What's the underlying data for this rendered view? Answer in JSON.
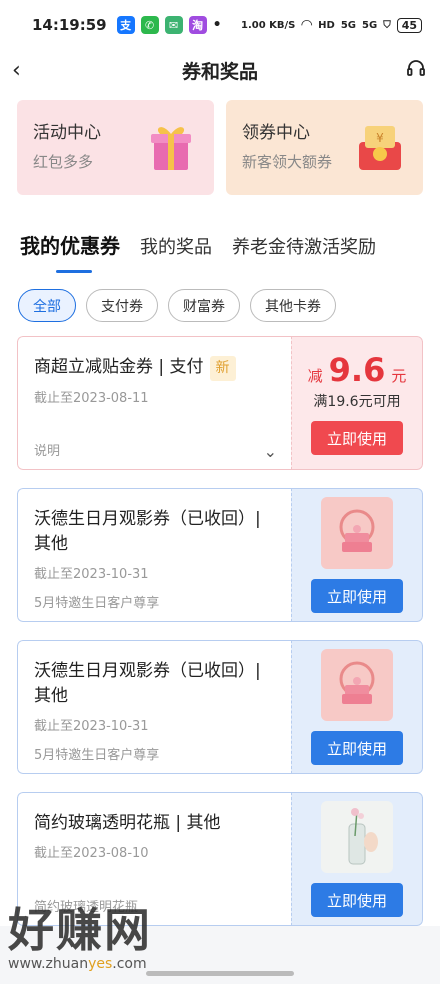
{
  "status": {
    "time": "14:19:59",
    "speed": "1.00 KB/S",
    "net1": "HD",
    "net2": "5G",
    "net3": "5G",
    "battery": "45"
  },
  "header": {
    "title": "券和奖品"
  },
  "top_cards": [
    {
      "title": "活动中心",
      "subtitle": "红包多多"
    },
    {
      "title": "领券中心",
      "subtitle": "新客领大额券"
    }
  ],
  "tabs": [
    "我的优惠券",
    "我的奖品",
    "养老金待激活奖励"
  ],
  "filters": [
    "全部",
    "支付券",
    "财富券",
    "其他卡券"
  ],
  "coupons": [
    {
      "name": "商超立减贴金券 | 支付",
      "badge": "新",
      "expiry": "截止至2023-08-11",
      "desc": "说明",
      "amount_prefix": "减",
      "amount": "9.6",
      "amount_unit": "元",
      "condition": "满19.6元可用",
      "button": "立即使用"
    },
    {
      "name": "沃德生日月观影券（已收回）| 其他",
      "expiry": "截止至2023-10-31",
      "desc": "5月特邀生日客户尊享",
      "button": "立即使用"
    },
    {
      "name": "沃德生日月观影券（已收回）| 其他",
      "expiry": "截止至2023-10-31",
      "desc": "5月特邀生日客户尊享",
      "button": "立即使用"
    },
    {
      "name": "简约玻璃透明花瓶 | 其他",
      "expiry": "截止至2023-08-10",
      "desc": "简约玻璃透明花瓶",
      "button": "立即使用"
    }
  ],
  "watermark": {
    "brand": "好赚网",
    "url_pre": "www.zhuan",
    "url_mid": "yes",
    "url_post": ".com"
  },
  "colors": {
    "accent": "#1e6fe0",
    "red": "#f0494f",
    "blue": "#2d7be5"
  }
}
